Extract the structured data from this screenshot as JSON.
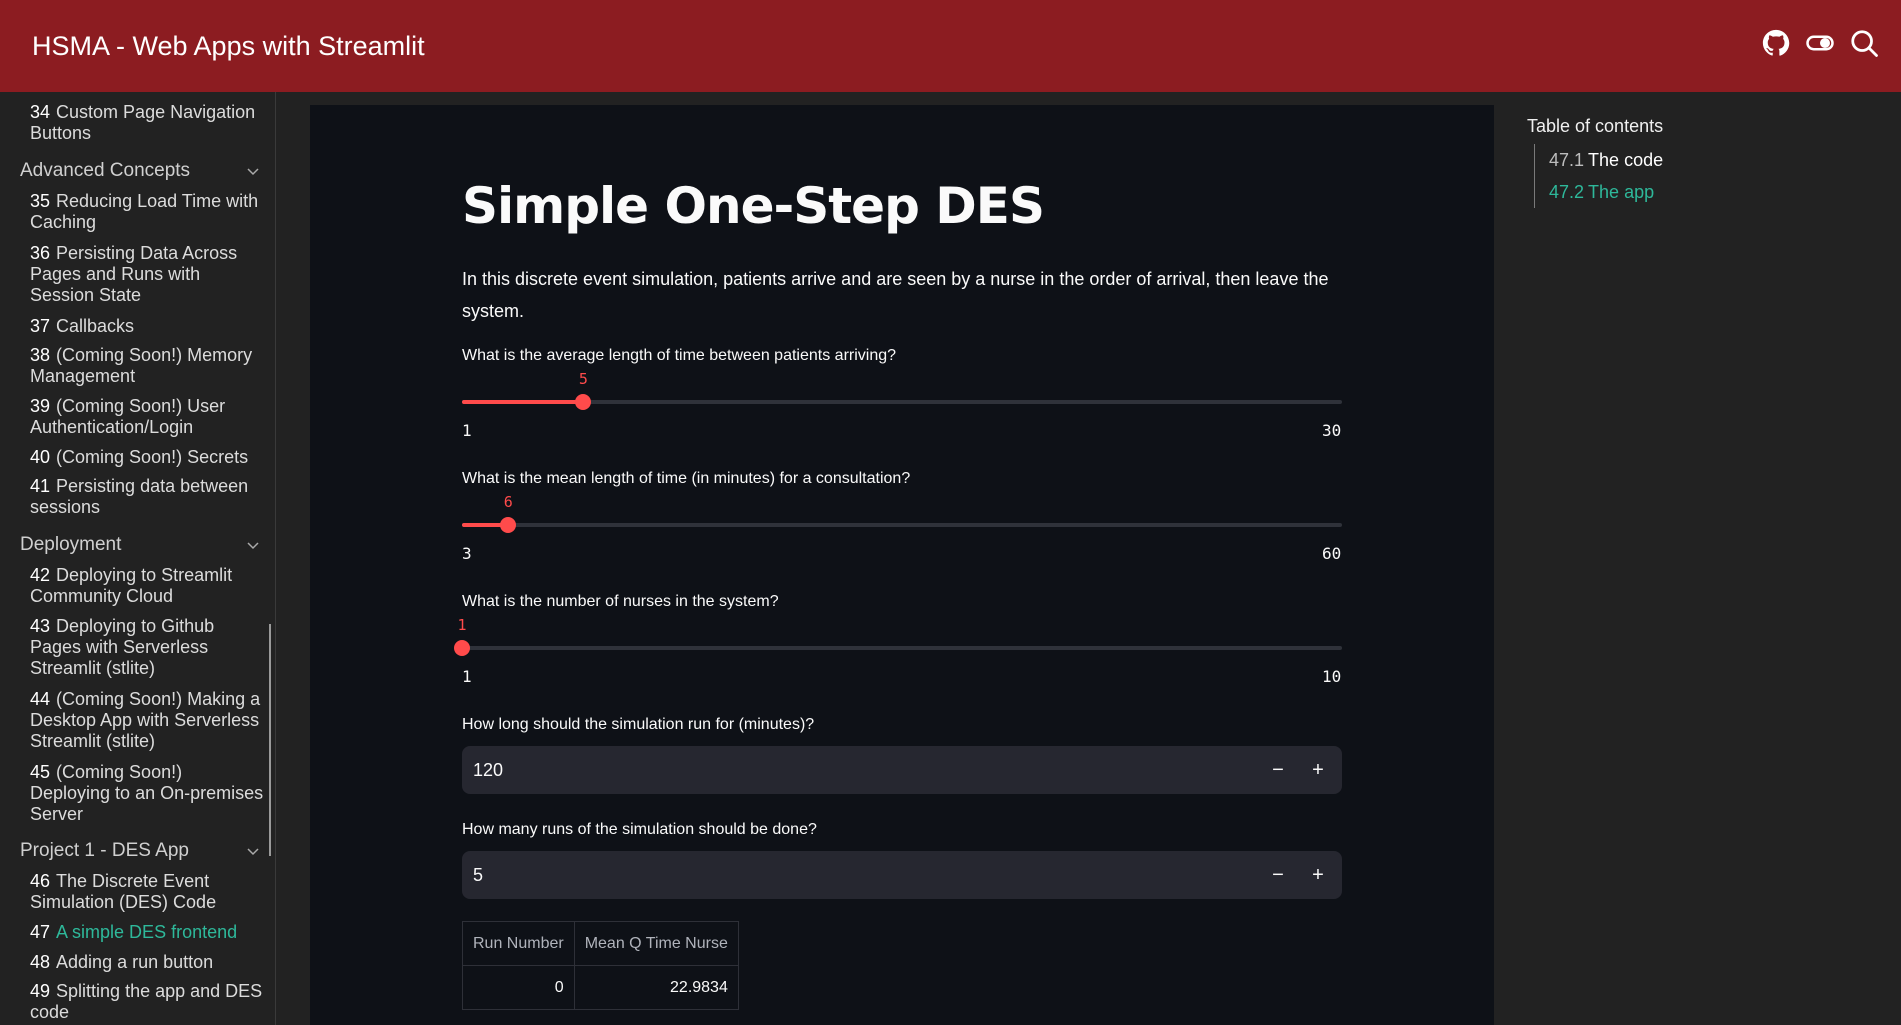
{
  "header": {
    "title": "HSMA - Web Apps with Streamlit",
    "icons": [
      "github-icon",
      "toggle-icon",
      "search-icon"
    ]
  },
  "sidebar": {
    "items": [
      {
        "num": "34",
        "label": "Custom Page Navigation Buttons"
      },
      {
        "section": "Advanced Concepts"
      },
      {
        "num": "35",
        "label": "Reducing Load Time with Caching"
      },
      {
        "num": "36",
        "label": "Persisting Data Across Pages and Runs with Session State"
      },
      {
        "num": "37",
        "label": "Callbacks"
      },
      {
        "num": "38",
        "label": "(Coming Soon!) Memory Management"
      },
      {
        "num": "39",
        "label": "(Coming Soon!) User Authentication/Login"
      },
      {
        "num": "40",
        "label": "(Coming Soon!) Secrets"
      },
      {
        "num": "41",
        "label": "Persisting data between sessions"
      },
      {
        "section": "Deployment"
      },
      {
        "num": "42",
        "label": "Deploying to Streamlit Community Cloud"
      },
      {
        "num": "43",
        "label": "Deploying to Github Pages with Serverless Streamlit (stlite)"
      },
      {
        "num": "44",
        "label": "(Coming Soon!) Making a Desktop App with Serverless Streamlit (stlite)"
      },
      {
        "num": "45",
        "label": "(Coming Soon!) Deploying to an On-premises Server"
      },
      {
        "section": "Project 1 - DES App"
      },
      {
        "num": "46",
        "label": "The Discrete Event Simulation (DES) Code"
      },
      {
        "num": "47",
        "label": "A simple DES frontend",
        "active": true
      },
      {
        "num": "48",
        "label": "Adding a run button"
      },
      {
        "num": "49",
        "label": "Splitting the app and DES code"
      }
    ]
  },
  "app": {
    "title": "Simple One-Step DES",
    "description": "In this discrete event simulation, patients arrive and are seen by a nurse in the order of arrival, then leave the system.",
    "sliders": [
      {
        "label": "What is the average length of time between patients arriving?",
        "value": 5,
        "min": 1,
        "max": 30
      },
      {
        "label": "What is the mean length of time (in minutes) for a consultation?",
        "value": 6,
        "min": 3,
        "max": 60
      },
      {
        "label": "What is the number of nurses in the system?",
        "value": 1,
        "min": 1,
        "max": 10
      }
    ],
    "number_inputs": [
      {
        "label": "How long should the simulation run for (minutes)?",
        "value": "120"
      },
      {
        "label": "How many runs of the simulation should be done?",
        "value": "5"
      }
    ],
    "table": {
      "headers": [
        "Run Number",
        "Mean Q Time Nurse"
      ],
      "rows": [
        [
          "0",
          "22.9834"
        ]
      ]
    },
    "accent_color": "#ff4b4b"
  },
  "toc": {
    "title": "Table of contents",
    "items": [
      {
        "num": "47.1",
        "label": "The code"
      },
      {
        "num": "47.2",
        "label": "The app",
        "active": true
      }
    ]
  },
  "colors": {
    "header_bg": "#8c1c21",
    "link_active": "#2eb89a"
  }
}
